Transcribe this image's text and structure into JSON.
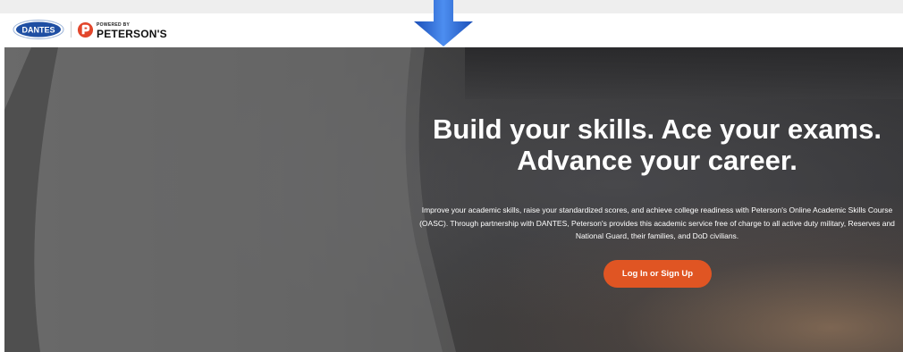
{
  "header": {
    "dantes_logo_text": "DANTES",
    "powered_by": "POWERED BY",
    "petersons": "PETERSON'S"
  },
  "hero": {
    "headline_line1": "Build your skills. Ace your exams.",
    "headline_line2": "Advance your career.",
    "description": "Improve your academic skills, raise your standardized scores, and achieve college readiness with Peterson's Online Academic Skills Course (OASC). Through partnership with DANTES, Peterson's provides this academic service free of charge to all active duty military, Reserves and National Guard, their families, and DoD civilians.",
    "cta_label": "Log In or Sign Up"
  },
  "annotation": {
    "icon": "down-arrow-icon",
    "color": "#2f6fd6"
  },
  "colors": {
    "cta": "#e05523",
    "brand_red": "#e2462b",
    "dantes_blue": "#1f4fa3"
  }
}
